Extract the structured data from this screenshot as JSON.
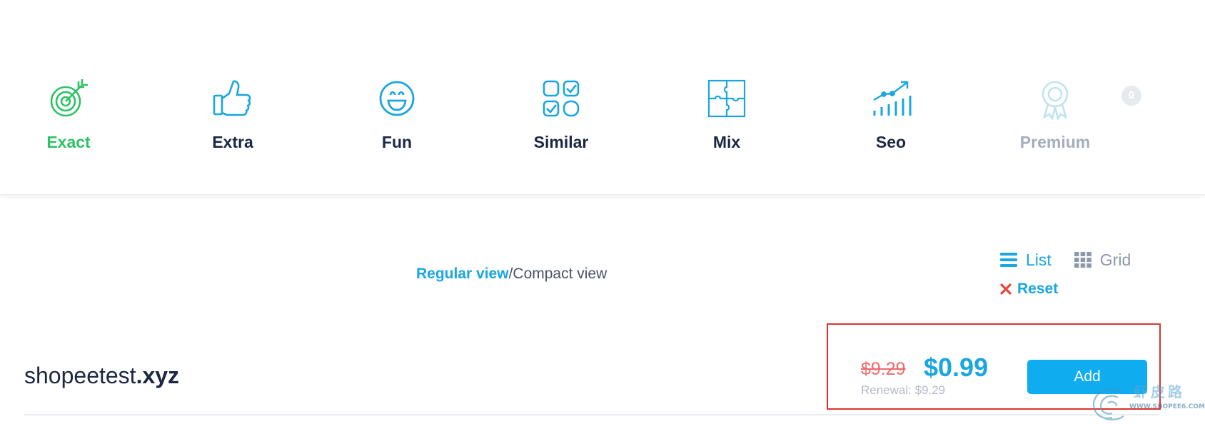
{
  "categories": [
    {
      "label": "Exact",
      "icon": "target-icon",
      "active": true
    },
    {
      "label": "Extra",
      "icon": "thumbs-up-icon"
    },
    {
      "label": "Fun",
      "icon": "smiley-icon"
    },
    {
      "label": "Similar",
      "icon": "checkbox-grid-icon"
    },
    {
      "label": "Mix",
      "icon": "puzzle-icon"
    },
    {
      "label": "Seo",
      "icon": "growth-chart-icon"
    },
    {
      "label": "Premium",
      "icon": "award-badge-icon",
      "badge_count": "0",
      "disabled": true
    }
  ],
  "view_toggle": {
    "regular": "Regular view",
    "separator": "/",
    "compact": "Compact view"
  },
  "layout_switch": {
    "list": "List",
    "grid": "Grid",
    "active": "List"
  },
  "reset_label": "Reset",
  "result": {
    "domain_name": "shopeetest",
    "domain_tld": ".xyz",
    "old_price": "$9.29",
    "new_price": "$0.99",
    "renewal": "Renewal: $9.29",
    "add_label": "Add"
  },
  "watermark": {
    "title": "虾皮路",
    "url": "WWW.SHOPEE6.COM"
  },
  "colors": {
    "accent_blue": "#1aa6e0",
    "active_green": "#2ec265",
    "dark_text": "#1b2743",
    "muted_text": "#a5adbc",
    "strike_red": "#ef6b6b",
    "highlight_red": "#d9352f",
    "button_blue": "#10acf0"
  }
}
